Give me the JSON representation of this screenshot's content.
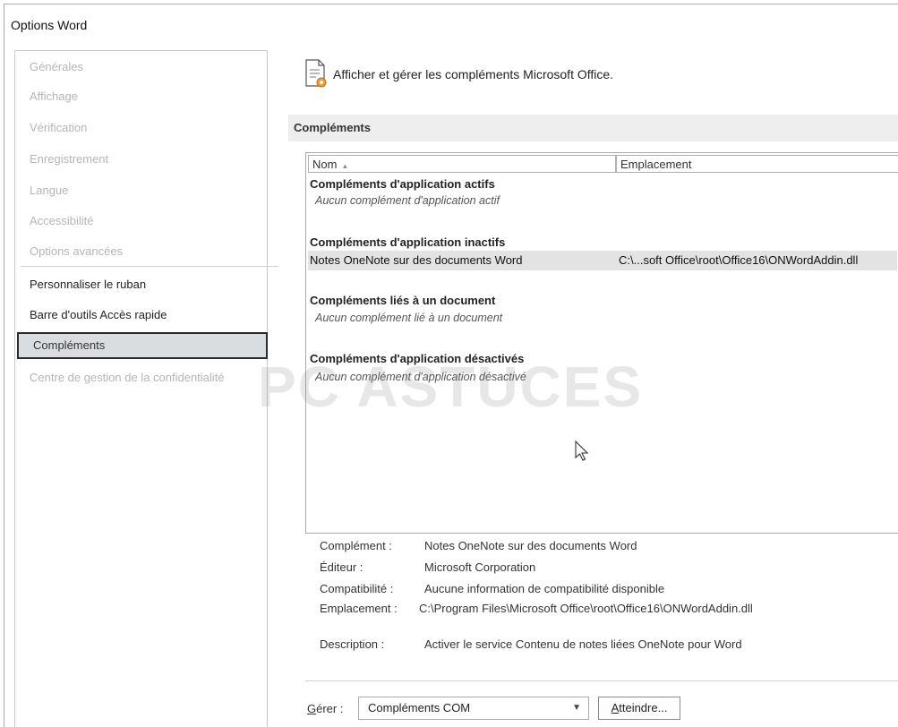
{
  "window": {
    "title": "Options Word"
  },
  "sidebar": {
    "items": [
      {
        "label": "Générales",
        "state": "disabled"
      },
      {
        "label": "Affichage",
        "state": "disabled"
      },
      {
        "label": "Vérification",
        "state": "disabled"
      },
      {
        "label": "Enregistrement",
        "state": "disabled"
      },
      {
        "label": "Langue",
        "state": "disabled"
      },
      {
        "label": "Accessibilité",
        "state": "disabled"
      },
      {
        "label": "Options avancées",
        "state": "disabled"
      },
      {
        "label": "Personnaliser le ruban",
        "state": "active"
      },
      {
        "label": "Barre d'outils Accès rapide",
        "state": "active"
      },
      {
        "label": "Compléments",
        "state": "selected"
      },
      {
        "label": "Centre de gestion de la confidentialité",
        "state": "disabled"
      }
    ]
  },
  "main": {
    "header": "Afficher et gérer les compléments Microsoft Office.",
    "section_title": "Compléments",
    "columns": {
      "name": "Nom",
      "location": "Emplacement",
      "sort_indicator": "▴"
    },
    "groups": {
      "active_title": "Compléments d'application actifs",
      "active_empty": "Aucun complément d'application actif",
      "inactive_title": "Compléments d'application inactifs",
      "inactive_row_name": "Notes OneNote sur des documents Word",
      "inactive_row_location": "C:\\...soft Office\\root\\Office16\\ONWordAddin.dll",
      "document_title": "Compléments liés à un document",
      "document_empty": "Aucun complément lié à un document",
      "disabled_title": "Compléments d'application désactivés",
      "disabled_empty": "Aucun complément d'application désactivé"
    },
    "watermark": "PC ASTUCES",
    "details": {
      "addin_label": "Complément :",
      "addin_value": "Notes OneNote sur des documents Word",
      "publisher_label": "Éditeur :",
      "publisher_value": "Microsoft Corporation",
      "compat_label": "Compatibilité :",
      "compat_value": "Aucune information de compatibilité disponible",
      "location_label": "Emplacement :",
      "location_value": "C:\\Program Files\\Microsoft Office\\root\\Office16\\ONWordAddin.dll",
      "description_label": "Description :",
      "description_value": "Activer le service Contenu de notes liées OneNote pour Word"
    },
    "manage": {
      "label_prefix": "G",
      "label_rest": "érer :",
      "selected": "Compléments COM",
      "go_prefix": "A",
      "go_rest": "tteindre..."
    }
  }
}
